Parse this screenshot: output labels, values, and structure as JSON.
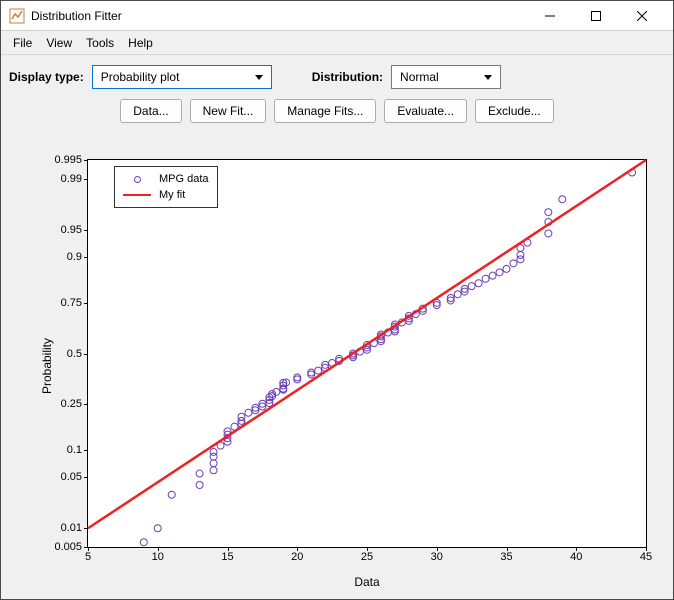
{
  "window": {
    "title": "Distribution Fitter"
  },
  "menubar": {
    "items": [
      "File",
      "View",
      "Tools",
      "Help"
    ]
  },
  "toolbar": {
    "display_type_label": "Display type:",
    "display_type_value": "Probability plot",
    "distribution_label": "Distribution:",
    "distribution_value": "Normal"
  },
  "buttons": {
    "data": "Data...",
    "new_fit": "New Fit...",
    "manage_fits": "Manage Fits...",
    "evaluate": "Evaluate...",
    "exclude": "Exclude..."
  },
  "plot": {
    "xlabel": "Data",
    "ylabel": "Probability",
    "legend": {
      "data": "MPG data",
      "fit": "My fit"
    },
    "x_ticks": [
      5,
      10,
      15,
      20,
      25,
      30,
      35,
      40,
      45
    ],
    "y_ticks_prob": [
      0.005,
      0.01,
      0.05,
      0.1,
      0.25,
      0.5,
      0.75,
      0.9,
      0.95,
      0.99,
      0.995
    ]
  },
  "chart_data": {
    "type": "scatter",
    "title": "",
    "xlabel": "Data",
    "ylabel": "Probability",
    "xlim": [
      5,
      45
    ],
    "y_scale": "normal-probit",
    "series": [
      {
        "name": "MPG data",
        "style": "open-circle",
        "color": "#6a3fb5",
        "x": [
          9.0,
          10.0,
          11.0,
          13.0,
          13.0,
          14.0,
          14.0,
          14.0,
          14.0,
          14.5,
          15.0,
          15.0,
          15.0,
          15.0,
          15.5,
          16.0,
          16.0,
          16.0,
          16.5,
          17.0,
          17.0,
          17.5,
          17.5,
          18.0,
          18.0,
          18.0,
          18.2,
          18.2,
          18.5,
          19.0,
          19.0,
          19.0,
          19.0,
          19.2,
          20.0,
          20.0,
          21.0,
          21.0,
          21.5,
          22.0,
          22.0,
          22.5,
          23.0,
          23.0,
          24.0,
          24.0,
          24.0,
          24.5,
          25.0,
          25.0,
          25.0,
          25.5,
          26.0,
          26.0,
          26.0,
          26.0,
          26.5,
          27.0,
          27.0,
          27.0,
          27.0,
          27.5,
          28.0,
          28.0,
          28.0,
          28.5,
          29.0,
          29.0,
          30.0,
          30.0,
          31.0,
          31.0,
          31.5,
          32.0,
          32.0,
          32.5,
          33.0,
          33.5,
          34.0,
          34.5,
          35.0,
          35.5,
          36.0,
          36.0,
          36.0,
          36.5,
          38.0,
          38.0,
          38.0,
          39.0,
          44.0
        ],
        "y_prob": [
          0.006,
          0.01,
          0.03,
          0.04,
          0.055,
          0.06,
          0.072,
          0.085,
          0.095,
          0.11,
          0.12,
          0.13,
          0.14,
          0.15,
          0.165,
          0.175,
          0.185,
          0.2,
          0.215,
          0.225,
          0.235,
          0.24,
          0.252,
          0.255,
          0.268,
          0.28,
          0.285,
          0.295,
          0.305,
          0.315,
          0.32,
          0.335,
          0.348,
          0.35,
          0.365,
          0.375,
          0.39,
          0.4,
          0.41,
          0.425,
          0.44,
          0.45,
          0.46,
          0.472,
          0.48,
          0.49,
          0.5,
          0.51,
          0.52,
          0.532,
          0.545,
          0.555,
          0.565,
          0.575,
          0.59,
          0.6,
          0.61,
          0.615,
          0.625,
          0.64,
          0.65,
          0.66,
          0.668,
          0.68,
          0.692,
          0.7,
          0.715,
          0.725,
          0.74,
          0.75,
          0.76,
          0.77,
          0.785,
          0.795,
          0.805,
          0.815,
          0.825,
          0.84,
          0.85,
          0.86,
          0.87,
          0.885,
          0.895,
          0.905,
          0.92,
          0.93,
          0.945,
          0.96,
          0.97,
          0.98,
          0.992
        ]
      },
      {
        "name": "My fit",
        "style": "line",
        "color": "#e22",
        "x": [
          5,
          45
        ],
        "y_prob": [
          0.01,
          0.995
        ]
      }
    ]
  }
}
